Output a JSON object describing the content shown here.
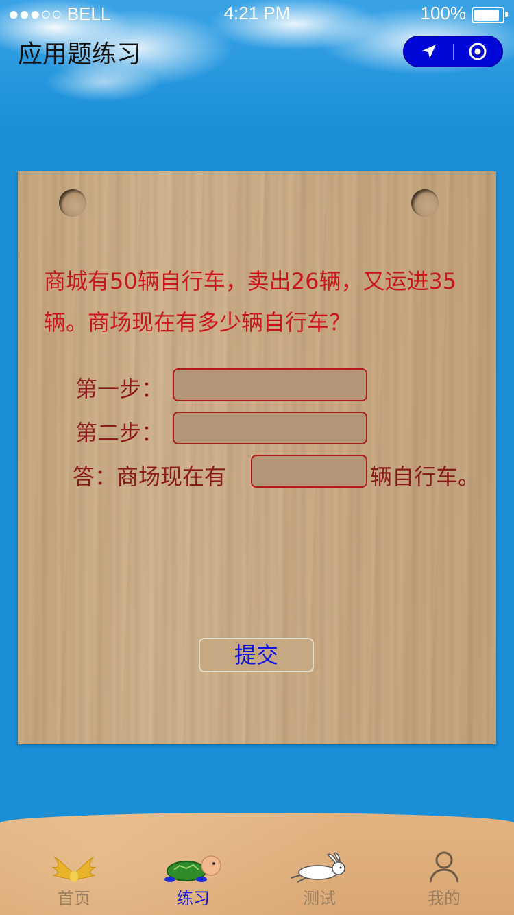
{
  "status_bar": {
    "carrier": "●●●○○ BELL",
    "time": "4:21 PM",
    "battery": "100%",
    "battery_level": 1.0
  },
  "header": {
    "title": "应用题练习",
    "capsule": {
      "left_icon": "navigation-arrow-icon",
      "right_icon": "target-circle-icon"
    }
  },
  "problem": {
    "question": "商城有50辆自行车，卖出26辆，又运进35辆。商场现在有多少辆自行车？",
    "step1_label": "第一步：",
    "step1_value": "",
    "step2_label": "第二步：",
    "step2_value": "",
    "answer_prefix": "答：商场现在有",
    "answer_value": "",
    "answer_suffix": "辆自行车。",
    "submit_label": "提交"
  },
  "tabbar": {
    "items": [
      {
        "label": "首页",
        "icon": "golden-wings-icon",
        "active": false
      },
      {
        "label": "练习",
        "icon": "turtle-icon",
        "active": true
      },
      {
        "label": "测试",
        "icon": "rabbit-icon",
        "active": false
      },
      {
        "label": "我的",
        "icon": "user-icon",
        "active": false
      }
    ]
  },
  "colors": {
    "background": "#1a8fd8",
    "question_text": "#c8171a",
    "label_text": "#8b1c1c",
    "submit_text": "#1212e0",
    "capsule": "#0008d8",
    "tab_active": "#1616e0",
    "tab_inactive": "#9a7f62"
  }
}
